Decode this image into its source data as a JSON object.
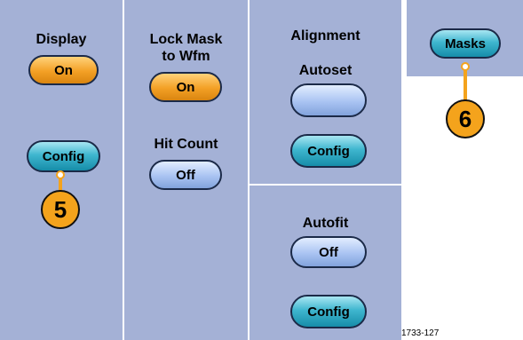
{
  "display": {
    "label": "Display",
    "button": "On",
    "config": "Config"
  },
  "lock_mask": {
    "label_line1": "Lock Mask",
    "label_line2": "to Wfm",
    "button": "On"
  },
  "hit_count": {
    "label": "Hit Count",
    "button": "Off"
  },
  "alignment": {
    "label": "Alignment",
    "autoset_label": "Autoset",
    "autoset_button": "",
    "config": "Config"
  },
  "autofit": {
    "label": "Autofit",
    "button": "Off",
    "config": "Config"
  },
  "masks": {
    "button": "Masks"
  },
  "callouts": {
    "c5": "5",
    "c6": "6"
  },
  "figure_number": "1733-127",
  "colors": {
    "panel": "#a4b1d6",
    "orange": "#f3a025",
    "teal": "#3fb6cf",
    "blue": "#a9c3f2"
  }
}
